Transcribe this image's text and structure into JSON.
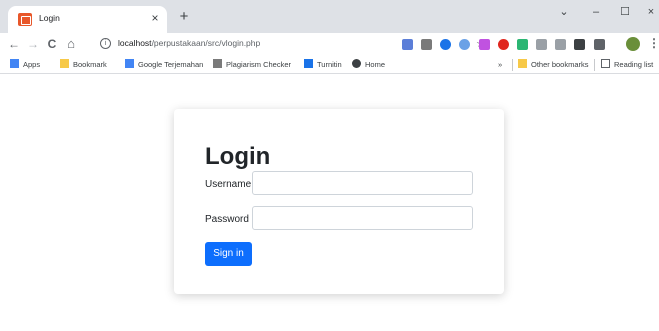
{
  "tab": {
    "title": "Login",
    "close": "×",
    "new_tab": "+"
  },
  "window": {
    "minimize": "–",
    "maximize": "☐",
    "close": "×",
    "collapse": "⌄"
  },
  "toolbar": {
    "back": "←",
    "forward": "→",
    "reload": "C",
    "home": "⌂",
    "url_host": "localhost",
    "url_path": "/perpustakaan/src/vlogin.php",
    "menu": "⋮"
  },
  "bookmarks": {
    "items": [
      {
        "label": "Apps",
        "icon": "apps-grid-icon",
        "color": "#4285f4"
      },
      {
        "label": "Bookmark",
        "icon": "folder-icon",
        "color": "#f7c948"
      },
      {
        "label": "Google Terjemahan",
        "icon": "translate-icon",
        "color": "#4285f4"
      },
      {
        "label": "Plagiarism Checker",
        "icon": "checker-icon",
        "color": "#7a7a7a"
      },
      {
        "label": "Turnitin",
        "icon": "turnitin-icon",
        "color": "#1a73e8"
      },
      {
        "label": "Home",
        "icon": "home-globe-icon",
        "color": "#3c4043"
      }
    ],
    "overflow": "»",
    "other": "Other bookmarks",
    "reading": "Reading list"
  },
  "login": {
    "title": "Login",
    "username_label": "Username",
    "username_value": "",
    "password_label": "Password",
    "password_value": "",
    "submit_label": "Sign in"
  },
  "colors": {
    "primary": "#0d6efd",
    "tabstrip": "#dee1e6",
    "favicon": "#e8572a"
  }
}
